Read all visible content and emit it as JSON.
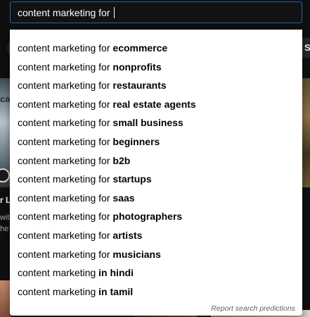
{
  "search": {
    "value": "content marketing for "
  },
  "background": {
    "chip_right_label": "S",
    "thumb_left_text": "ca",
    "side_text_1": "r Lo",
    "side_text_2": "wit",
    "side_text_3": "he f"
  },
  "suggestions": [
    {
      "prefix": "content marketing for ",
      "suffix": "ecommerce"
    },
    {
      "prefix": "content marketing for ",
      "suffix": "nonprofits"
    },
    {
      "prefix": "content marketing for ",
      "suffix": "restaurants"
    },
    {
      "prefix": "content marketing for ",
      "suffix": "real estate agents"
    },
    {
      "prefix": "content marketing for ",
      "suffix": "small business"
    },
    {
      "prefix": "content marketing for ",
      "suffix": "beginners"
    },
    {
      "prefix": "content marketing for ",
      "suffix": "b2b"
    },
    {
      "prefix": "content marketing for ",
      "suffix": "startups"
    },
    {
      "prefix": "content marketing for ",
      "suffix": "saas"
    },
    {
      "prefix": "content marketing for ",
      "suffix": "photographers"
    },
    {
      "prefix": "content marketing for ",
      "suffix": "artists"
    },
    {
      "prefix": "content marketing for ",
      "suffix": "musicians"
    },
    {
      "prefix": "content marketing ",
      "suffix": "in hindi"
    },
    {
      "prefix": "content marketing ",
      "suffix": "in tamil"
    }
  ],
  "report_link": "Report search predictions",
  "colors": {
    "page_bg": "#0f0f0f",
    "search_border": "#1c62b9",
    "dropdown_bg": "#ffffff",
    "suggestion_text": "#030303"
  }
}
